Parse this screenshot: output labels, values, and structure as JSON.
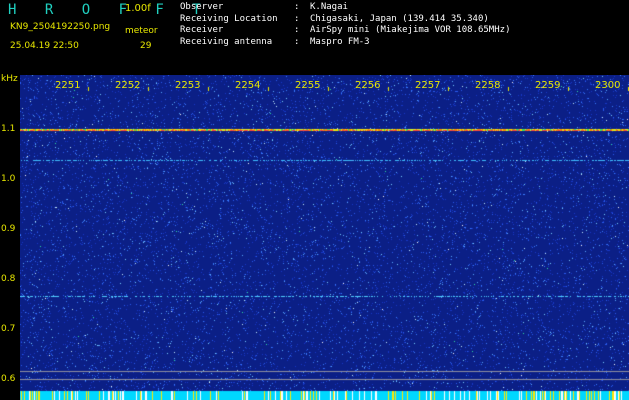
{
  "header": {
    "app_title": "H R O F F T",
    "version": "1.00f",
    "file_name": "KN9_2504192250.png",
    "meteor_label": "meteor",
    "datetime": "25.04.19 22:50",
    "meteor_count": "29"
  },
  "info": [
    {
      "key": "Observer",
      "value": "K.Nagai"
    },
    {
      "key": "Receiving Location",
      "value": "Chigasaki, Japan (139.414 35.340)"
    },
    {
      "key": "Receiver",
      "value": "AirSpy mini (Miakejima VOR 108.65MHz)"
    },
    {
      "key": "Receiving antenna",
      "value": "Maspro FM-3"
    }
  ],
  "colon": ":",
  "axis": {
    "unit": "kHz",
    "y_ticks": [
      "1.1",
      "1.0",
      "0.9",
      "0.8",
      "0.7",
      "0.6"
    ],
    "time_ticks": [
      "2251",
      "2252",
      "2253",
      "2254",
      "2255",
      "2256",
      "2257",
      "2258",
      "2259",
      "2300"
    ]
  },
  "colors": {
    "background": "#0b1f86",
    "label_yellow": "#e8e800",
    "title_cyan": "#20d0c0",
    "bottom_band": "#00d8ff"
  }
}
